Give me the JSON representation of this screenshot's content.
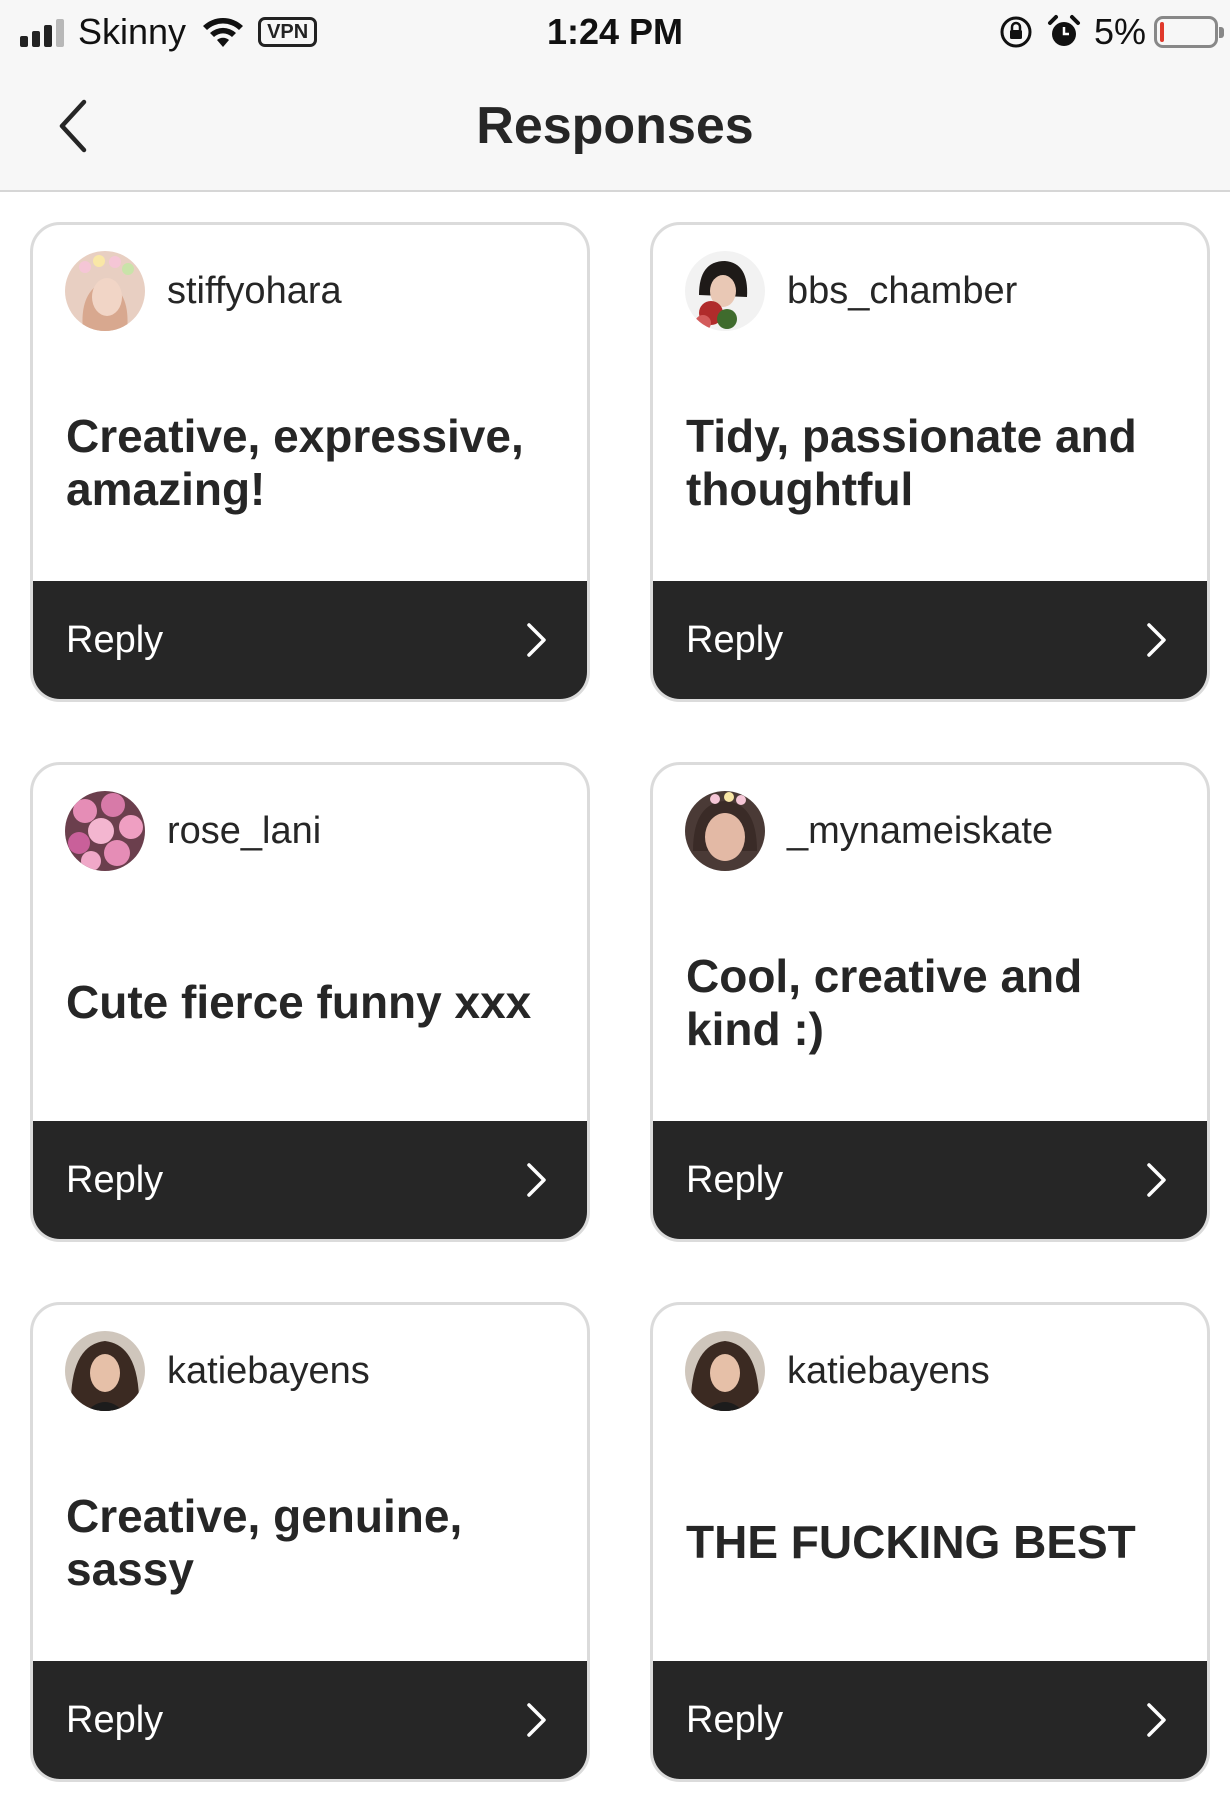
{
  "status_bar": {
    "carrier": "Skinny",
    "vpn": "VPN",
    "time": "1:24 PM",
    "battery": "5%",
    "battery_level": 0.05,
    "icons": [
      "signal-icon",
      "wifi-icon",
      "orientation-lock-icon",
      "alarm-icon",
      "battery-icon"
    ]
  },
  "nav": {
    "title": "Responses",
    "back_icon": "chevron-left-icon"
  },
  "responses": [
    {
      "username": "stiffyohara",
      "text": "Creative, expressive, amazing!",
      "reply": "Reply"
    },
    {
      "username": "bbs_chamber",
      "text": "Tidy, passionate and thoughtful",
      "reply": "Reply"
    },
    {
      "username": "rose_lani",
      "text": "Cute fierce funny xxx",
      "reply": "Reply"
    },
    {
      "username": "_mynameiskate",
      "text": "Cool, creative and kind :)",
      "reply": "Reply"
    },
    {
      "username": "katiebayens",
      "text": "Creative, genuine, sassy",
      "reply": "Reply"
    },
    {
      "username": "katiebayens",
      "text": "THE FUCKING BEST",
      "reply": "Reply"
    }
  ],
  "colors": {
    "reply_bar": "#262626",
    "card_border": "#dbdbdb",
    "battery_low": "#e0392b"
  }
}
